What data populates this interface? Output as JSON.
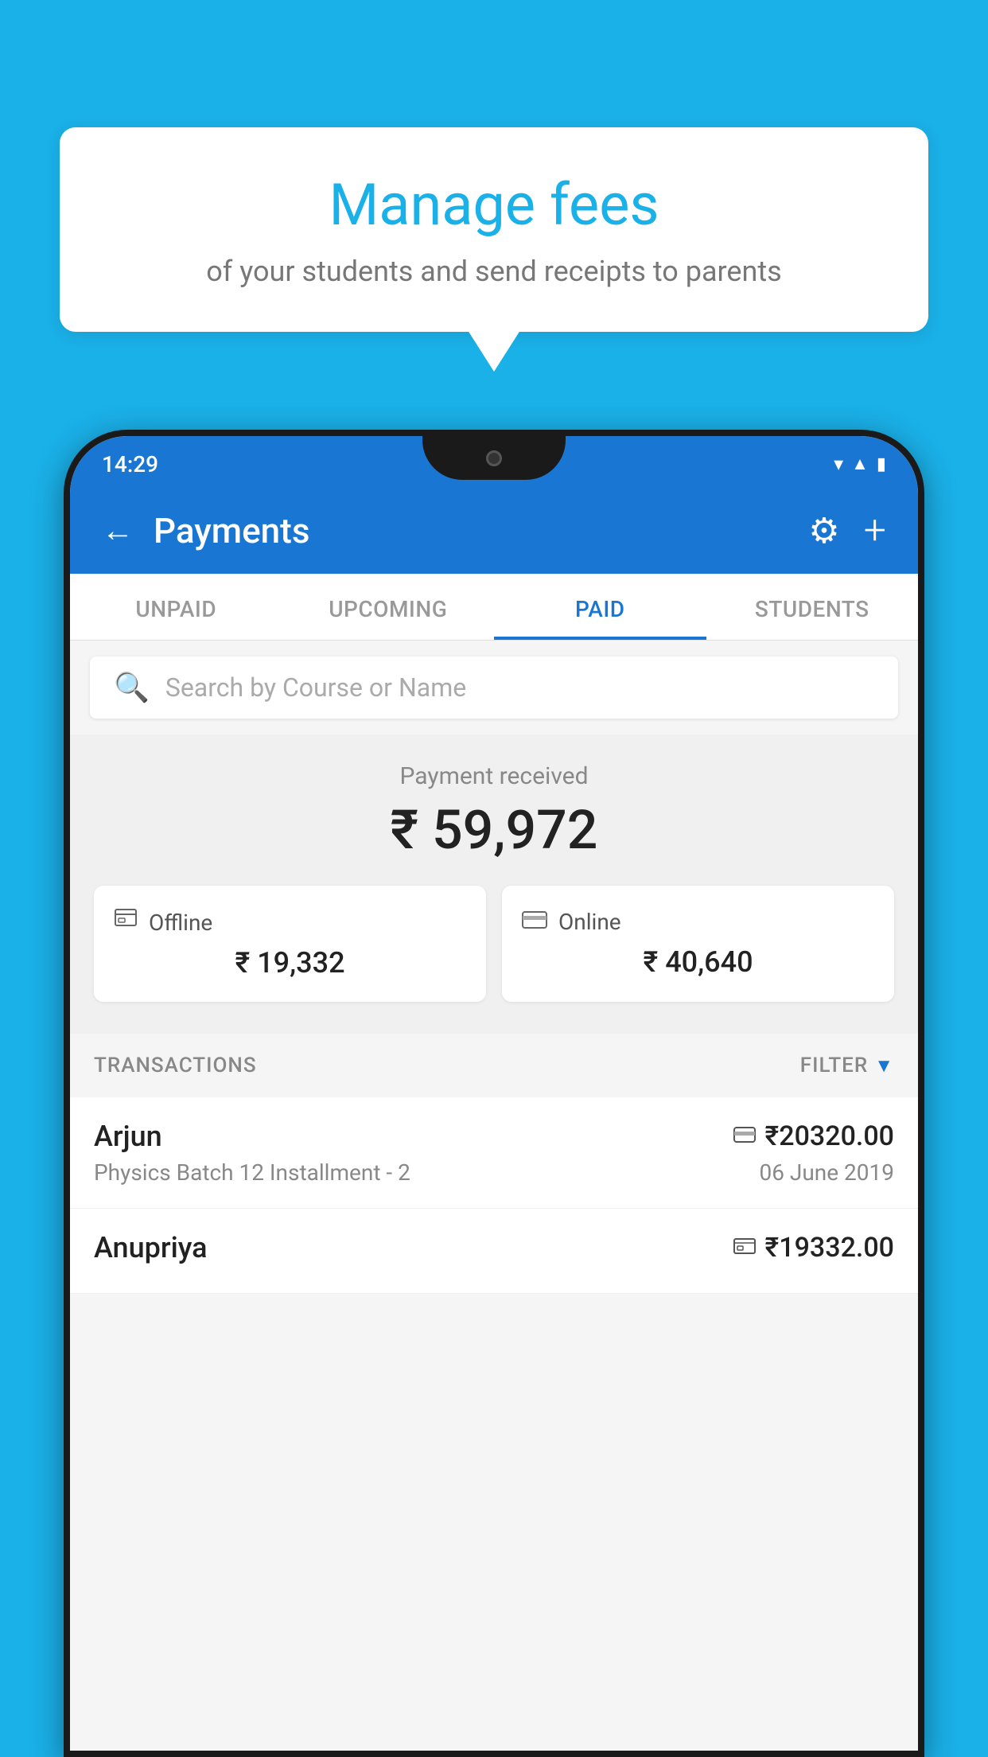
{
  "page": {
    "background_color": "#1ab0e8"
  },
  "speech_bubble": {
    "title": "Manage fees",
    "subtitle": "of your students and send receipts to parents"
  },
  "status_bar": {
    "time": "14:29"
  },
  "app_header": {
    "title": "Payments",
    "back_label": "←",
    "plus_label": "+"
  },
  "tabs": [
    {
      "label": "UNPAID",
      "active": false
    },
    {
      "label": "UPCOMING",
      "active": false
    },
    {
      "label": "PAID",
      "active": true
    },
    {
      "label": "STUDENTS",
      "active": false
    }
  ],
  "search": {
    "placeholder": "Search by Course or Name"
  },
  "payment_summary": {
    "label": "Payment received",
    "amount": "₹ 59,972",
    "offline": {
      "type": "Offline",
      "amount": "₹ 19,332"
    },
    "online": {
      "type": "Online",
      "amount": "₹ 40,640"
    }
  },
  "transactions": {
    "label": "TRANSACTIONS",
    "filter_label": "FILTER",
    "items": [
      {
        "name": "Arjun",
        "course": "Physics Batch 12 Installment - 2",
        "amount": "₹20320.00",
        "date": "06 June 2019",
        "type": "online"
      },
      {
        "name": "Anupriya",
        "course": "",
        "amount": "₹19332.00",
        "date": "",
        "type": "offline"
      }
    ]
  }
}
